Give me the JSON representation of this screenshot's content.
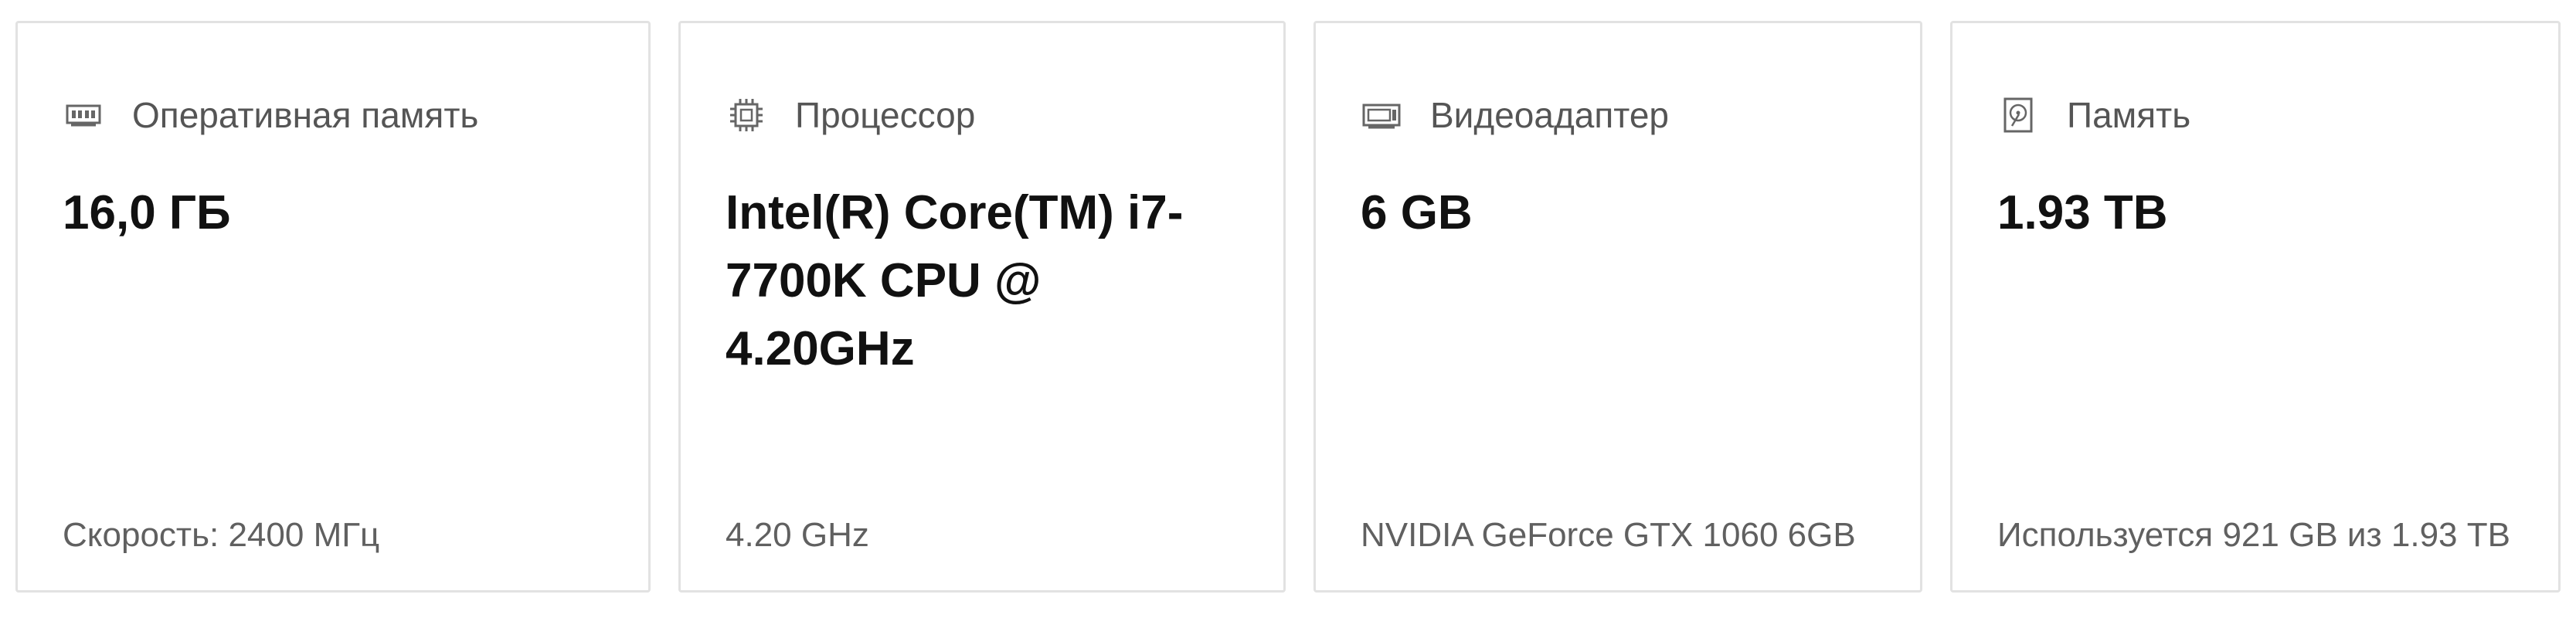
{
  "cards": [
    {
      "icon": "memory-icon",
      "label": "Оперативная память",
      "value": "16,0 ГБ",
      "detail": "Скорость: 2400 МГц"
    },
    {
      "icon": "processor-icon",
      "label": "Процессор",
      "value": "Intel(R) Core(TM) i7-7700K CPU @ 4.20GHz",
      "detail": "4.20 GHz"
    },
    {
      "icon": "display-adapter-icon",
      "label": "Видеоадаптер",
      "value": "6 GB",
      "detail": "NVIDIA GeForce GTX 1060 6GB"
    },
    {
      "icon": "storage-drive-icon",
      "label": "Память",
      "value": "1.93 TB",
      "detail": "Используется 921 GB из 1.93 TB"
    }
  ],
  "colors": {
    "card_border": "#e2e2e2",
    "label_text": "#555555",
    "value_text": "#111111",
    "detail_text": "#606060",
    "icon_stroke": "#666666"
  }
}
